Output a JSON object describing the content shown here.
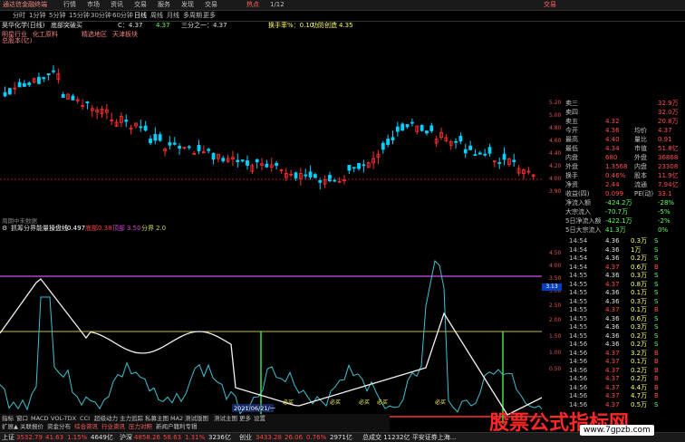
{
  "titlebar": {
    "app": "通达信金融终端",
    "menus": [
      "行情",
      "市场",
      "资讯",
      "交易",
      "服务"
    ],
    "mid": [
      "发现",
      "交易",
      "热点",
      "1/12"
    ],
    "right": "交易"
  },
  "periods": [
    "分时",
    "1分钟",
    "5分钟",
    "15分钟",
    "30分钟",
    "60分钟",
    "日线",
    "周线",
    "月线",
    "多周期",
    "更多"
  ],
  "info": {
    "stock": "昊华化学(日线)",
    "signal": "底部突破买",
    "c": "C：4.37",
    "qty": "4.37",
    "three_high": "三分之一：4.37",
    "turnover": "换手率%：0.10",
    "flow": "功防创造",
    "flow_val": "4.35",
    "ind1": "明星行业",
    "ind2": "化工原料",
    "ind3": "精选地区",
    "ind4": "天津板块",
    "ind5": "总股本(亿)"
  },
  "main_axis": [
    "5.20",
    "5.00",
    "4.80",
    "4.60",
    "4.40",
    "4.20",
    "4.00",
    "3.90"
  ],
  "ind_label": "周期中未数据",
  "sub": {
    "title": "抓筹分界能量",
    "a_label": "操盘线",
    "a": "0.497",
    "b_label": "底部",
    "b": "0.38",
    "c_label": "顶部",
    "c": "3.50",
    "d_label": "分界",
    "d": "2.0"
  },
  "sub_axis": [
    "4.50",
    "4.00",
    "3.50",
    "3.00",
    "2.50",
    "2.00",
    "1.50",
    "1.00",
    "0.50"
  ],
  "sub_axis_box": "3.13",
  "date_label": "2021/06/21/一",
  "bottom_marks": [
    "必买",
    "必买",
    "必买",
    "必买",
    "必买"
  ],
  "quotes": [
    {
      "k": "卖三",
      "v": "",
      "q": "32.9万"
    },
    {
      "k": "卖四",
      "v": "",
      "q": "32.0万"
    },
    {
      "k": "卖五",
      "v": "4.32",
      "q": "20.8万"
    },
    {
      "k": "今开",
      "v": "4.36",
      "k2": "均价",
      "v2": "4.37"
    },
    {
      "k": "最高",
      "v": "4.40",
      "k2": "量比",
      "v2": "0.91"
    },
    {
      "k": "最低",
      "v": "4.34",
      "k2": "市值",
      "v2": "51.8亿"
    },
    {
      "k": "内盘",
      "v": "680",
      "k2": "外盘",
      "v2": "36868"
    },
    {
      "k": "外盘",
      "v": "1.3568",
      "k2": "内盘",
      "v2": "23308"
    },
    {
      "k": "换手",
      "v": "0.46%",
      "k2": "股本",
      "v2": "11.9亿"
    },
    {
      "k": "净资",
      "v": "2.44",
      "k2": "流通",
      "v2": "7.94亿"
    },
    {
      "k": "收益(四)",
      "v": "0.099",
      "k2": "PE(动)",
      "v2": "33.1"
    },
    {
      "k": "净流入额",
      "v": "-424.2万",
      "v2": "-28%"
    },
    {
      "k": "大宗流入",
      "v": "-70.7万",
      "v2": "-5%"
    },
    {
      "k": "5日净流入额",
      "v": "-422.1万",
      "v2": "-2%"
    },
    {
      "k": "5日大宗流入",
      "v": "41.3万",
      "v2": "0%"
    }
  ],
  "ticks": [
    {
      "t": "14:54",
      "p": "4.36",
      "q": "0.3万",
      "s": "S"
    },
    {
      "t": "14:54",
      "p": "4.36",
      "q": "1万",
      "s": "S"
    },
    {
      "t": "14:54",
      "p": "4.36",
      "q": "0.2万",
      "s": "S"
    },
    {
      "t": "14:54",
      "p": "4.37",
      "q": "0.6万",
      "s": "B"
    },
    {
      "t": "14:55",
      "p": "4.36",
      "q": "0.3万",
      "s": "S"
    },
    {
      "t": "14:55",
      "p": "4.37",
      "q": "0.8万",
      "s": "S"
    },
    {
      "t": "14:55",
      "p": "4.36",
      "q": "0.1万",
      "s": "S"
    },
    {
      "t": "14:55",
      "p": "4.36",
      "q": "0.3万",
      "s": "S"
    },
    {
      "t": "14:55",
      "p": "4.37",
      "q": "0.1万",
      "s": "B"
    },
    {
      "t": "14:55",
      "p": "4.36",
      "q": "0.6万",
      "s": "S"
    },
    {
      "t": "14:55",
      "p": "4.36",
      "q": "0.3万",
      "s": "S"
    },
    {
      "t": "14:55",
      "p": "4.36",
      "q": "0.2万",
      "s": "S"
    },
    {
      "t": "14:56",
      "p": "4.36",
      "q": "0.2万",
      "s": "S"
    },
    {
      "t": "14:56",
      "p": "4.37",
      "q": "3.2万",
      "s": "B"
    },
    {
      "t": "14:56",
      "p": "4.37",
      "q": "0.1万",
      "s": "B"
    },
    {
      "t": "14:56",
      "p": "4.37",
      "q": "0.2万",
      "s": "B"
    },
    {
      "t": "14:56",
      "p": "4.37",
      "q": "0.2万",
      "s": "B"
    },
    {
      "t": "14:56",
      "p": "4.37",
      "q": "4.4万",
      "s": "B"
    },
    {
      "t": "14:56",
      "p": "4.37",
      "q": "4.7万",
      "s": "B"
    },
    {
      "t": "14:56",
      "p": "4.37",
      "q": "0.5万",
      "s": "S"
    }
  ],
  "tabs_row1": [
    "指标",
    "窗口",
    "MACD",
    "VOL-TDX",
    "CCI",
    "超级动力",
    "主力追踪",
    "私募主图",
    "MA2",
    "测试版图",
    "测试主图",
    "更多",
    "设置"
  ],
  "tabs_row2": [
    "扩展▲",
    "关联报价",
    "资金分布",
    "综合资讯",
    "行业资讯",
    "压力对照",
    "新闻户籍利专辑"
  ],
  "status": [
    {
      "k": "上证",
      "v": "3532.79",
      "c": "41.63",
      "p": "1.15%",
      "a": "4649亿"
    },
    {
      "k": "沪深",
      "v": "4858.26",
      "c": "58.63",
      "p": "1.31%",
      "a": "3236亿"
    },
    {
      "k": "创业",
      "v": "3433.28",
      "c": "26.06",
      "p": "0.76%",
      "a": "2971亿"
    }
  ],
  "status_tail": "总成交 11232亿 平安证券上海...",
  "watermark": "股票公式指标网",
  "watermark_url": "www.7gpzb.com"
}
